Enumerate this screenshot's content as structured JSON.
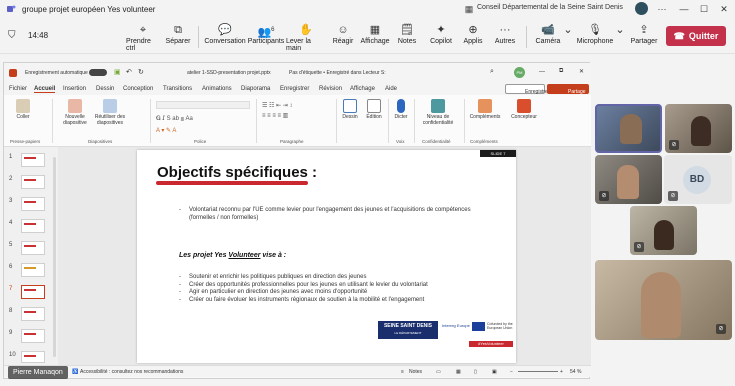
{
  "window": {
    "title": "groupe projet européen Yes volunteer",
    "org": "Conseil Départemental de la Seine Saint Denis"
  },
  "meeting": {
    "timer": "14:48",
    "participants_count": "6",
    "tools": [
      {
        "label": "Prendre ctrl",
        "icon": "cursor-icon"
      },
      {
        "label": "Séparer",
        "icon": "pop-out-icon"
      },
      {
        "label": "Conversation",
        "icon": "chat-icon"
      },
      {
        "label": "Participants",
        "icon": "people-icon"
      },
      {
        "label": "Lever la main",
        "icon": "hand-icon"
      },
      {
        "label": "Réagir",
        "icon": "smile-icon"
      },
      {
        "label": "Affichage",
        "icon": "grid-icon"
      },
      {
        "label": "Notes",
        "icon": "notes-icon"
      },
      {
        "label": "Copilot",
        "icon": "copilot-icon"
      },
      {
        "label": "Applis",
        "icon": "plus-icon"
      },
      {
        "label": "Autres",
        "icon": "more-icon"
      },
      {
        "label": "Caméra",
        "icon": "camera-icon"
      },
      {
        "label": "Microphone",
        "icon": "mic-icon"
      },
      {
        "label": "Partager",
        "icon": "share-icon"
      }
    ],
    "quit_label": "Quitter"
  },
  "ppt": {
    "autosave": "Enregistrement automatique",
    "filename": "atelier 1-SSD-presentation projet.pptx",
    "label_status": "Pas d'étiquette • Enregistré dans Lecteur S:",
    "user_initials": "PM",
    "menu": [
      "Fichier",
      "Accueil",
      "Insertion",
      "Dessin",
      "Conception",
      "Transitions",
      "Animations",
      "Diaporama",
      "Enregistrer",
      "Révision",
      "Affichage",
      "Aide"
    ],
    "enregistrer_btn": "Enregistrer",
    "partage_btn": "Partage",
    "ribbon": {
      "coller": "Coller",
      "nouvelle_diapo": "Nouvelle diapositive",
      "reutiliser": "Réutiliser des diapositives",
      "dessin": "Dessin",
      "edition": "Édition",
      "dicter": "Dicter",
      "niveau": "Niveau de confidentialité",
      "complements": "Compléments",
      "concepteur": "Concepteur",
      "groups": [
        "Presse-papiers",
        "Diapositives",
        "Police",
        "Paragraphe",
        "Voix",
        "Confidentialité",
        "Compléments"
      ]
    },
    "thumb_numbers": [
      "1",
      "2",
      "3",
      "4",
      "5",
      "6",
      "7",
      "8",
      "9",
      "10"
    ],
    "slide": {
      "tag": "SLIDE 7",
      "title": "Objectifs spécifiques :",
      "intro_bullets": [
        "Volontariat reconnu par l'UE comme levier pour l'engagement des jeunes et l'acquisitions de compétences (formelles / non formelles)"
      ],
      "subheading_prefix": "Les projet Yes ",
      "subheading_underlined": "Volunteer",
      "subheading_suffix": " vise à :",
      "bullets": [
        "Soutenir et enrichir les politiques publiques en direction des jeunes",
        "Créer des opportunités professionnelles pour les jeunes en utilisant le levier du volontariat",
        "Agir en particulier en direction des jeunes avec moins d'opportunité",
        "Créer ou faire évoluer les instruments régionaux de soutien à la mobilité et l'engagement"
      ],
      "logo_ssd": "SEINE SAINT DENIS",
      "logo_ssd_sub": "LE DÉPARTEMENT",
      "logo_erasmus": "Interreg Europe",
      "logo_eu": "Cofunded by the European Union",
      "hashtag": "#YesVolunteer"
    },
    "status": {
      "accessibility": "Accessibilité : consultez nos recommandations",
      "notes": "Notes",
      "zoom": "54 %"
    }
  },
  "participants": {
    "bd_initials": "BD",
    "presenter_name": "Pierre Manaqon"
  }
}
